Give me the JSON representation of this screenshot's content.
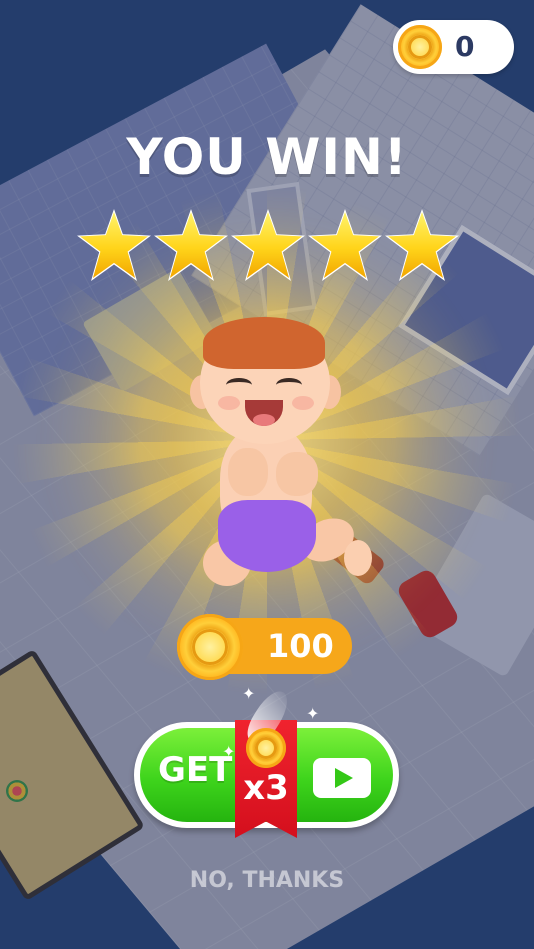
{
  "hud": {
    "coin_count": "0",
    "coin_icon": "gold-coin-icon"
  },
  "result": {
    "title": "YOU WIN!",
    "stars_earned": 5,
    "stars_total": 5,
    "star_icon": "gold-star-icon"
  },
  "reward": {
    "amount": "100",
    "coin_icon": "gold-coin-icon"
  },
  "get_button": {
    "label": "GET",
    "multiplier": "x3",
    "icon": "play-video-icon",
    "color": "#3ed41c"
  },
  "decline": {
    "label": "NO, THANKS"
  },
  "colors": {
    "background": "#2d4f82",
    "coin": "#ffc21f",
    "reward_pill": "#f6a71a",
    "ribbon": "#e0141f"
  }
}
